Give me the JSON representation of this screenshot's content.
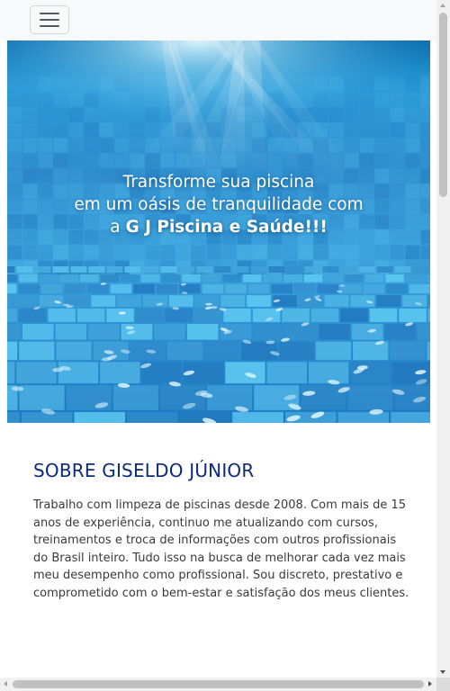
{
  "navbar": {
    "toggle_icon": "hamburger-menu-icon"
  },
  "hero": {
    "line1": "Transforme sua piscina",
    "line2": "em um oásis de tranquilidade com",
    "line3_prefix": "a ",
    "line3_brand": "G J Piscina e Saúde!!!",
    "colors": {
      "water_light": "#3ab4ea",
      "water_dark": "#0a5f9e",
      "tile_light": "#5ec8f2",
      "tile_dark": "#1b6fb8"
    }
  },
  "about": {
    "title": "SOBRE GISELDO JÚNIOR",
    "body": "Trabalho com limpeza de piscinas desde 2008. Com mais de 15 anos de experiência, continuo me atualizando com cursos, treinamentos e troca de informações com outros profissionais do Brasil inteiro. Tudo isso na busca de melhorar cada vez mais meu desempenho como profissional. Sou discreto, prestativo e comprometido com o bem-estar e satisfação dos meus clientes."
  },
  "colors": {
    "heading": "#0b2a7a",
    "body_text": "#3a3a3a",
    "navbar_bg": "#f8f9fa"
  }
}
